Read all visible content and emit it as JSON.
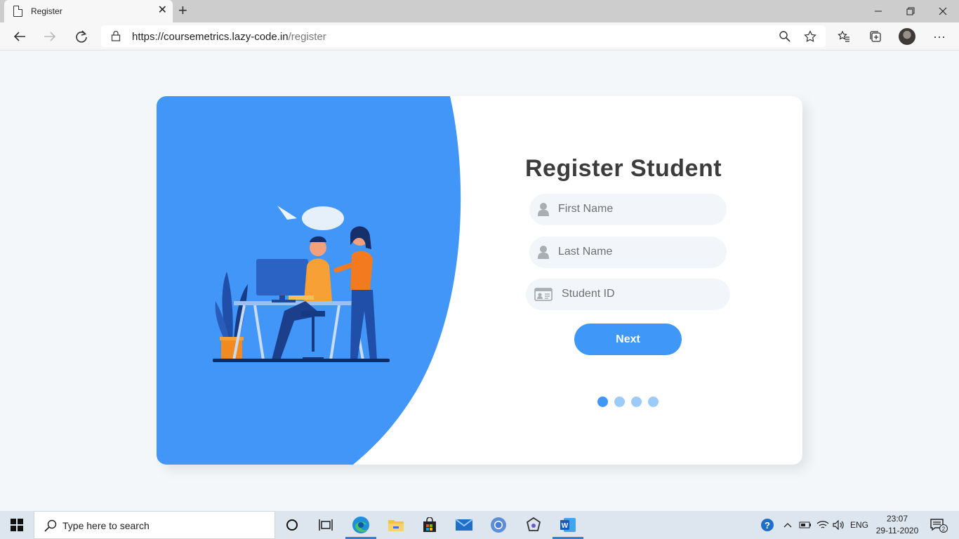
{
  "browser": {
    "tab_title": "Register",
    "tab_close": "✕",
    "new_tab": "+",
    "url_host": "https://coursemetrics.lazy-code.in",
    "url_path": "/register",
    "window_controls": {
      "minimize": "—",
      "restore": "❐",
      "close": "✕"
    },
    "icons": [
      "back-icon",
      "forward-icon",
      "refresh-icon",
      "lock-icon",
      "zoom-icon",
      "star-icon",
      "favorites-icon",
      "collections-icon",
      "profile-avatar",
      "more-icon"
    ],
    "more": "···"
  },
  "page": {
    "title": "Register Student",
    "fields": {
      "first_name_placeholder": "First Name",
      "last_name_placeholder": "Last Name",
      "student_id_placeholder": "Student ID"
    },
    "next_label": "Next",
    "step_dots": {
      "count": 4,
      "active_index": 0
    },
    "colors": {
      "accent": "#3f98f8",
      "panel_blue": "#4296f7",
      "title": "#3c3c3c",
      "field_bg": "#f2f6fa"
    }
  },
  "taskbar": {
    "search_placeholder": "Type here to search",
    "apps": [
      "cortana-icon",
      "task-view-icon",
      "edge-icon",
      "file-explorer-icon",
      "store-icon",
      "mail-icon",
      "chrome-icon",
      "app-icon",
      "word-icon"
    ],
    "tray": {
      "language": "ENG",
      "time": "23:07",
      "date": "29-11-2020",
      "notification_count": "2"
    }
  }
}
